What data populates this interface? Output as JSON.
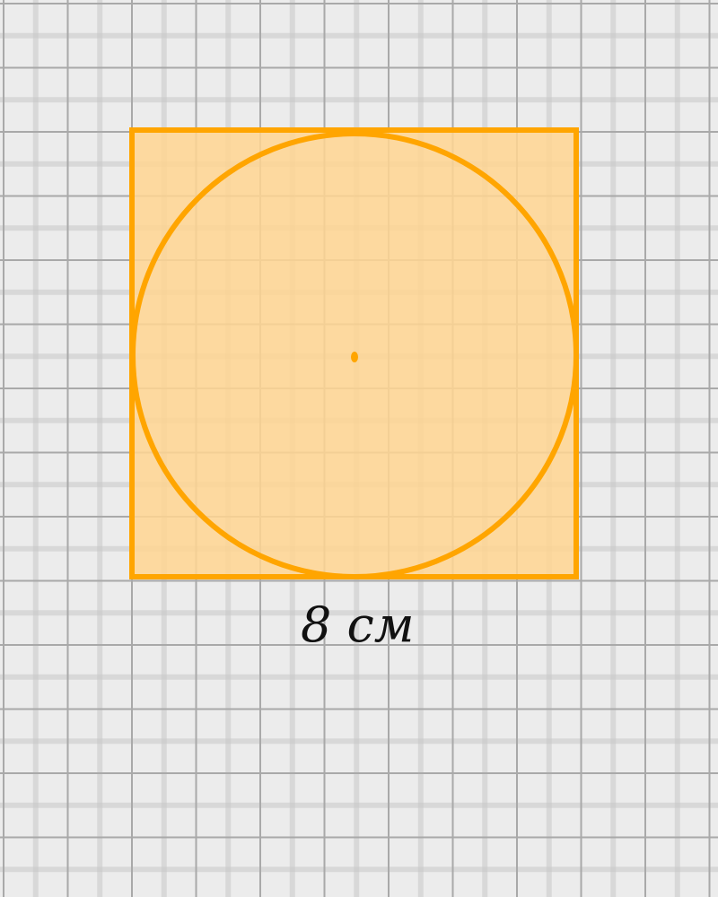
{
  "figure": {
    "side_label": "8 см",
    "shapes": [
      "square",
      "inscribed-circle",
      "center-point"
    ]
  },
  "colors": {
    "paper": "#ececec",
    "grid": "#a9a9a9",
    "square_fill": "#ffd591",
    "square_stroke": "#ffa500",
    "circle_stroke": "#ffa500",
    "center_point": "#ffa500",
    "label": "#111111"
  }
}
